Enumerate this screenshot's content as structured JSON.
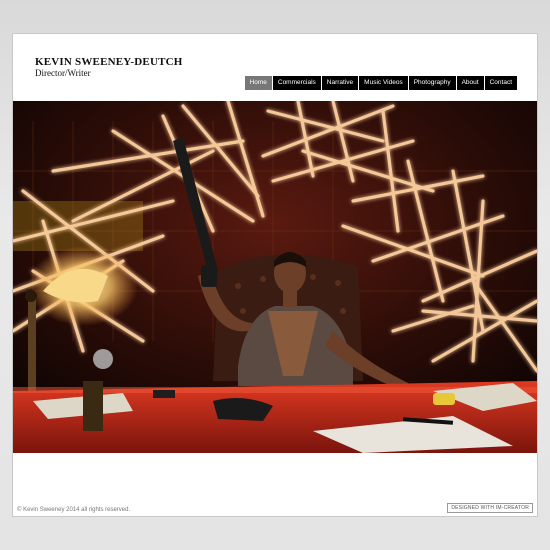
{
  "site": {
    "name": "KEVIN SWEENEY-DEUTCH",
    "role": "Director/Writer"
  },
  "nav": {
    "items": [
      {
        "label": "Home",
        "active": true
      },
      {
        "label": "Commercials",
        "active": false
      },
      {
        "label": "Narrative",
        "active": false
      },
      {
        "label": "Music Videos",
        "active": false
      },
      {
        "label": "Photography",
        "active": false
      },
      {
        "label": "About",
        "active": false
      },
      {
        "label": "Contact",
        "active": false
      }
    ]
  },
  "hero": {
    "icon": "hero-photo"
  },
  "footer": {
    "copyright": "© Kevin Sweeney 2014 all rights reserved.",
    "badge": "DESIGNED WITH IM-CREATOR"
  },
  "colors": {
    "nav_bg": "#000000",
    "nav_active_bg": "#777777",
    "neon": "#ffb070",
    "desk": "#c42a1a"
  }
}
